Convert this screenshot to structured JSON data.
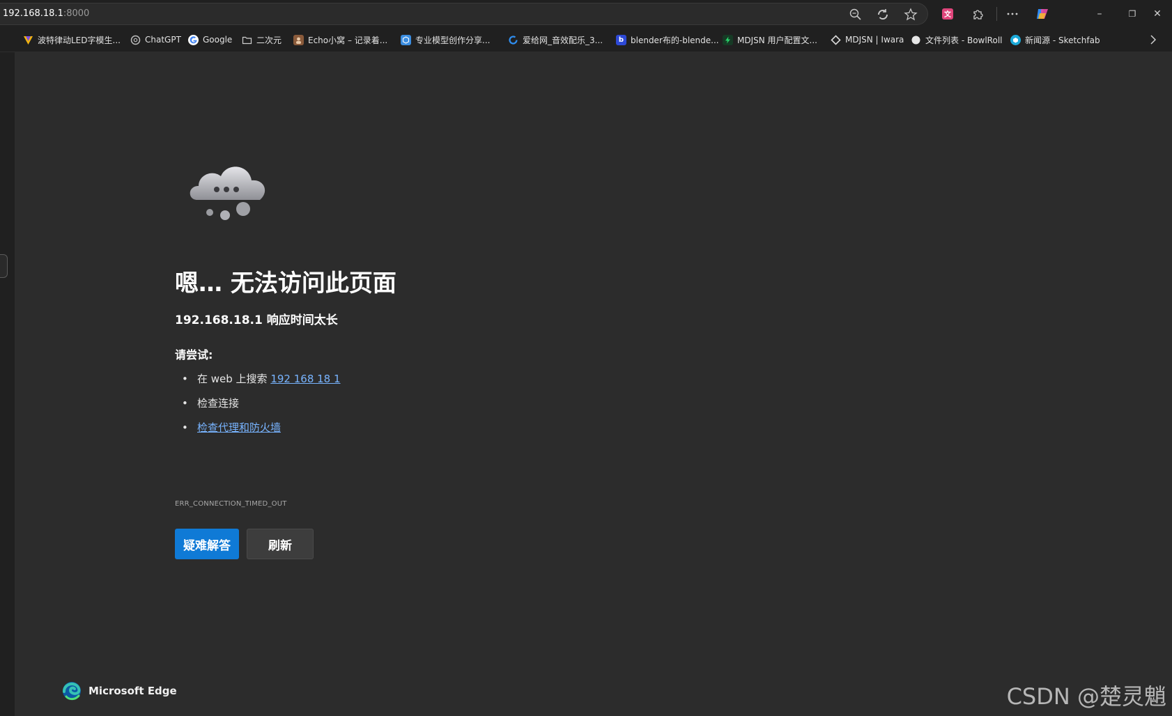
{
  "address_bar": {
    "host": "192.168.18.1",
    "port": ":8000"
  },
  "window_controls": {
    "minimize": "–",
    "restore": "❐",
    "close": "✕"
  },
  "bookmarks": [
    {
      "label": "波特律动LED字模生...",
      "icon": "colorful-v-icon",
      "color": "#f2b50f"
    },
    {
      "label": "ChatGPT",
      "icon": "openai-icon",
      "color": "#9a9a9a"
    },
    {
      "label": "Google",
      "icon": "google-icon",
      "color": "#ffffff"
    },
    {
      "label": "二次元",
      "icon": "folder-icon",
      "color": "#cfcfcf"
    },
    {
      "label": "Echo小窝 – 记录着...",
      "icon": "avatar-icon",
      "color": "#8a5a3a"
    },
    {
      "label": "专业模型创作分享...",
      "icon": "model-site-icon",
      "color": "#3b8de0"
    },
    {
      "label": "爱给网_音效配乐_3...",
      "icon": "aigei-icon",
      "color": "#2f8ef0"
    },
    {
      "label": "blender布的-blende...",
      "icon": "b-icon",
      "color": "#2d49d6"
    },
    {
      "label": "MDJSN 用户配置文...",
      "icon": "lightning-icon",
      "color": "#1d9e4d"
    },
    {
      "label": "MDJSN | Iwara",
      "icon": "diamond-icon",
      "color": "#d9d9d9"
    },
    {
      "label": "文件列表 - BowlRoll",
      "icon": "circle-icon",
      "color": "#e6e6e6"
    },
    {
      "label": "新闻源 - Sketchfab",
      "icon": "sketchfab-icon",
      "color": "#1caad9"
    }
  ],
  "error": {
    "title": "嗯… 无法访问此页面",
    "subtitle": "192.168.18.1 响应时间太长",
    "try_label": "请尝试:",
    "tip1_prefix": "在 web 上搜索 ",
    "tip1_link": "192 168 18 1",
    "tip2": "检查连接",
    "tip3_link": "检查代理和防火墙",
    "code": "ERR_CONNECTION_TIMED_OUT",
    "troubleshoot_button": "疑难解答",
    "refresh_button": "刷新",
    "bullet": "•"
  },
  "brand": {
    "name": "Microsoft Edge"
  },
  "watermark": "CSDN @楚灵魈",
  "colors": {
    "accent": "#0f7ad6",
    "link": "#78b4ff",
    "page_bg": "#2c2c2c"
  }
}
